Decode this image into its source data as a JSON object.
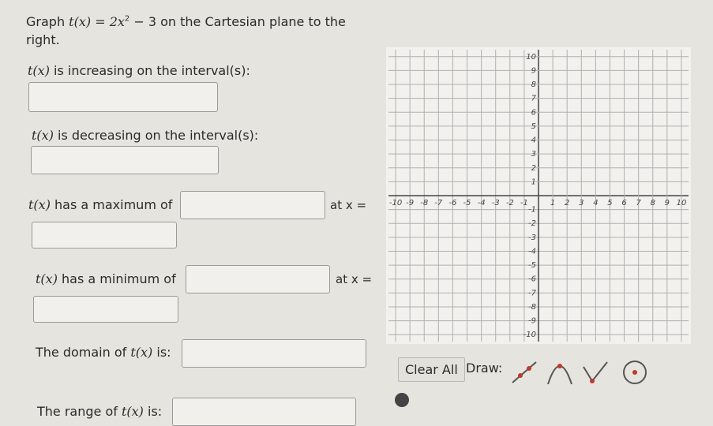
{
  "question": {
    "prefix": "Graph",
    "func": "t(x) = 2x",
    "exp": "2",
    "func_rest": " − 3",
    "suffix_line1": " on the Cartesian plane to the",
    "suffix_line2": "right."
  },
  "increasing": {
    "fn": "t(x)",
    "label": " is increasing on the interval(s):"
  },
  "decreasing": {
    "fn": "t(x)",
    "label": " is decreasing on the interval(s):"
  },
  "maximum": {
    "fn": "t(x)",
    "label": " has a maximum of",
    "at_label": "at x ="
  },
  "minimum": {
    "fn": "t(x)",
    "label": " has a minimum of",
    "at_label": "at x ="
  },
  "domain": {
    "prefix": "The domain of ",
    "fn": "t(x)",
    "suffix": " is:"
  },
  "range": {
    "prefix": "The range of ",
    "fn": "t(x)",
    "suffix": " is:"
  },
  "graph": {
    "x_ticks": [
      "-10",
      "-9",
      "-8",
      "-7",
      "-6",
      "-5",
      "-4",
      "-3",
      "-2",
      "-1",
      "1",
      "2",
      "3",
      "4",
      "5",
      "6",
      "7",
      "8",
      "9",
      "10"
    ],
    "y_ticks": [
      "10",
      "9",
      "8",
      "7",
      "6",
      "5",
      "4",
      "3",
      "2",
      "1",
      "-1",
      "-2",
      "-3",
      "-4",
      "-5",
      "-6",
      "-7",
      "-8",
      "-9",
      "-10"
    ]
  },
  "toolbar": {
    "clear_label": "Clear All",
    "draw_label": "Draw:",
    "tools": [
      "line-tool-icon",
      "parabola-tool-icon",
      "absolute-value-tool-icon",
      "circle-tool-icon"
    ]
  }
}
